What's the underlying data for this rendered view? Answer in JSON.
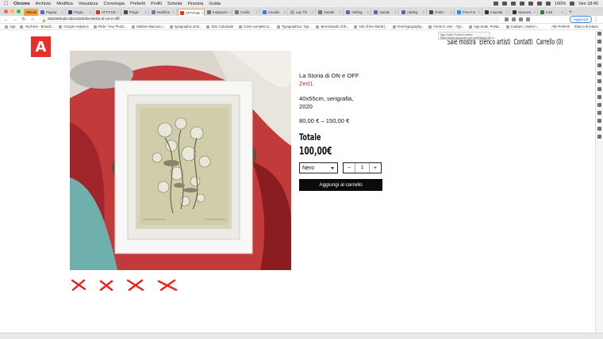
{
  "menubar": {
    "items": [
      "Chrome",
      "Archivio",
      "Modifica",
      "Visualizza",
      "Cronologia",
      "Preferiti",
      "Profili",
      "Scheda",
      "Finestra",
      "Guida"
    ],
    "battery": "100%",
    "clock": "Ven 18:40"
  },
  "tabs": [
    {
      "label": "Attitude",
      "color": "#f2a440",
      "type": "group"
    },
    {
      "label": "Pagina",
      "color": "#4a6ee0"
    },
    {
      "label": "Plugin",
      "color": "#3b4a6b"
    },
    {
      "label": "ATTITUD",
      "color": "#e63027"
    },
    {
      "label": "Plugin",
      "color": "#3b4a6b"
    },
    {
      "label": "Modifica",
      "color": "#6a7ea0"
    },
    {
      "label": "ATTITUD",
      "color": "#e63027",
      "type": "active"
    },
    {
      "label": "Integrazio",
      "color": "#777"
    },
    {
      "label": "Codici",
      "color": "#777"
    },
    {
      "label": "Cloudin",
      "color": "#3a7bd5"
    },
    {
      "label": "Lay Thr",
      "color": "#aaa"
    },
    {
      "label": "Variabi",
      "color": "#777"
    },
    {
      "label": "Adding",
      "color": "#7f54b3"
    },
    {
      "label": "Variabi",
      "color": "#7f54b3"
    },
    {
      "label": "Adding",
      "color": "#7f54b3"
    },
    {
      "label": "Ordini",
      "color": "#3b4a6b"
    },
    {
      "label": "Free For",
      "color": "#1e90ff"
    },
    {
      "label": "Imposta",
      "color": "#333"
    },
    {
      "label": "Openwa",
      "color": "#333"
    },
    {
      "label": "Instl",
      "color": "#2e7d32"
    }
  ],
  "address": {
    "url": "startattitude.it/prodotto/la-storia-di-on-e-off/",
    "update_label": "Aggiorna"
  },
  "bookmarks": {
    "items": [
      "App",
      "YouTube - Broadc...",
      "Google Analytics",
      "Flickr: Your Photo...",
      "Stefano Marconi |...",
      "typographic post...",
      "Size Calculator",
      "Corso completo p...",
      "Typographica. Typ...",
      "Best Brands of th...",
      "Ads of the World |...",
      "FreeTypography...",
      "Fonts In Use – Typ...",
      "App Suite. Posta...",
      "Codepo | Useful i..."
    ],
    "right_items": [
      "Altri Preferiti",
      "Elenco di lettura"
    ]
  },
  "tooltip": {
    "line1": "App Suite. Posta in arrivo",
    "line2": "https://www.appsuite.ovh.net/#!&app=io.ox..."
  },
  "site": {
    "logo": "A",
    "nav": [
      "Sale mostra",
      "Elenco artisti",
      "Contatti",
      "Carrello (0)"
    ],
    "product": {
      "title": "La Storia di ON e OFF",
      "artist": "Zed1",
      "dimensions": "40x55cm, serigrafia,",
      "year": "2020",
      "price_range": "80,00 € – 150,00 €",
      "total_label": "Totale",
      "total_value": "100,00€",
      "variant_selected": "Nero",
      "quantity": "1",
      "minus": "−",
      "plus": "+",
      "add_to_cart": "Aggiungi al carrello"
    },
    "accent_color": "#e63027"
  }
}
